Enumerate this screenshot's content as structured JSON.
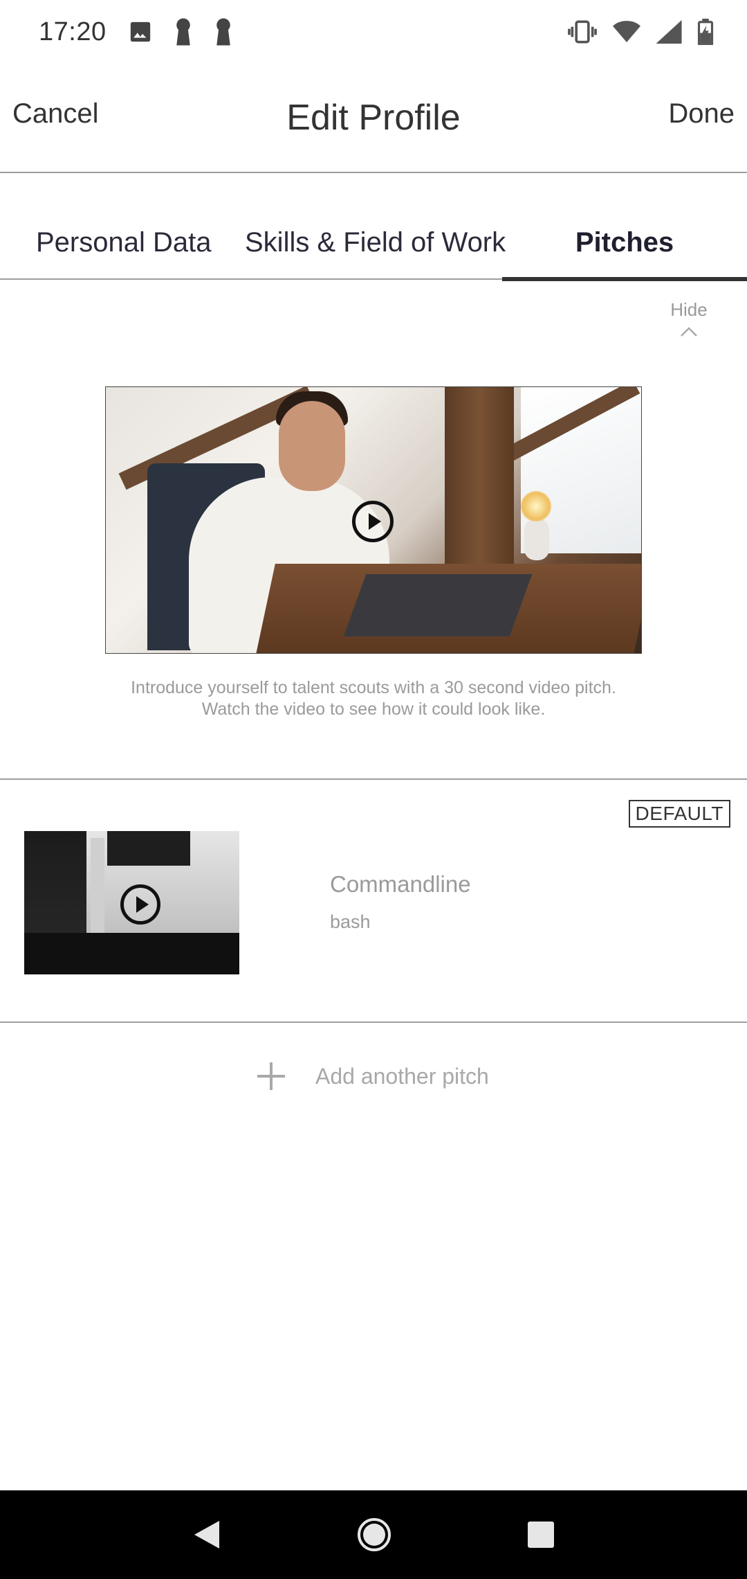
{
  "status_bar": {
    "time": "17:20",
    "left_icons": [
      "image-icon",
      "keyhole-icon",
      "keyhole-icon"
    ],
    "right_icons": [
      "vibrate-icon",
      "wifi-icon",
      "signal-icon",
      "battery-charging-icon"
    ]
  },
  "app_bar": {
    "cancel_label": "Cancel",
    "title": "Edit Profile",
    "done_label": "Done"
  },
  "tabs": [
    {
      "label": "Personal Data",
      "selected": false
    },
    {
      "label": "Skills & Field of Work",
      "selected": false
    },
    {
      "label": "Pitches",
      "selected": true
    }
  ],
  "hide_toggle": {
    "label": "Hide"
  },
  "intro": {
    "line1": "Introduce yourself to talent scouts with a 30 second video pitch.",
    "line2": "Watch the video to see how it could look like."
  },
  "pitch": {
    "badge": "DEFAULT",
    "title": "Commandline",
    "subtitle": "bash"
  },
  "add_pitch": {
    "label": "Add another pitch"
  },
  "nav_bar": {
    "buttons": [
      "back-icon",
      "home-icon",
      "recents-icon"
    ]
  }
}
